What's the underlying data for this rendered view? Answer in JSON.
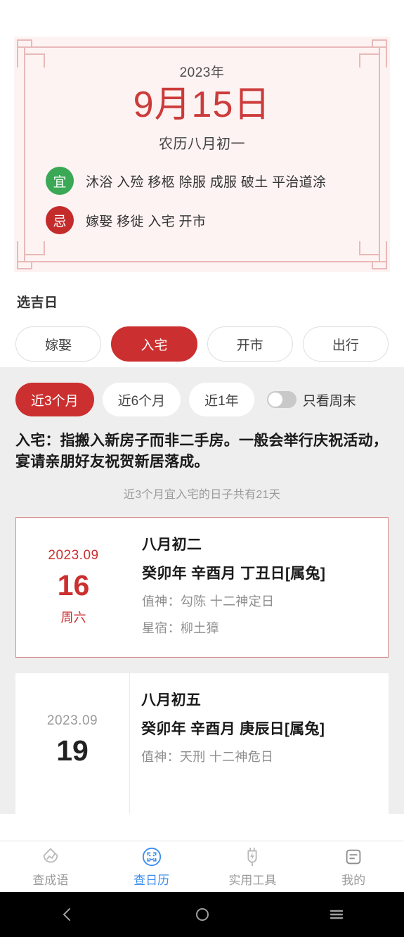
{
  "almanac": {
    "year": "2023年",
    "date": "9月15日",
    "lunar": "农历八月初一",
    "yi_badge": "宜",
    "yi_items": "沐浴 入殓 移柩 除服 成服 破土 平治道涂",
    "ji_badge": "忌",
    "ji_items": "嫁娶 移徙 入宅 开市"
  },
  "picker": {
    "title": "选吉日",
    "options": [
      {
        "label": "嫁娶",
        "active": false
      },
      {
        "label": "入宅",
        "active": true
      },
      {
        "label": "开市",
        "active": false
      },
      {
        "label": "出行",
        "active": false
      }
    ]
  },
  "filters": {
    "ranges": [
      {
        "label": "近3个月",
        "active": true
      },
      {
        "label": "近6个月",
        "active": false
      },
      {
        "label": "近1年",
        "active": false
      }
    ],
    "weekend_toggle_label": "只看周末",
    "weekend_toggle_on": false
  },
  "summary": {
    "description": "入宅：指搬入新房子而非二手房。一般会举行庆祝活动，宴请亲朋好友祝贺新居落成。",
    "count_text": "近3个月宜入宅的日子共有21天"
  },
  "days": [
    {
      "year_month": "2023.09",
      "day": "16",
      "weekday": "周六",
      "lunar_day": "八月初二",
      "ganzhi": "癸卯年 辛酉月 丁丑日[属兔]",
      "zhishen": "值神：勾陈  十二神定日",
      "xingxiu": "星宿：柳土獐",
      "highlight": true
    },
    {
      "year_month": "2023.09",
      "day": "19",
      "weekday": "",
      "lunar_day": "八月初五",
      "ganzhi": "癸卯年 辛酉月 庚辰日[属兔]",
      "zhishen": "值神：天刑  十二神危日",
      "xingxiu": "",
      "highlight": false
    }
  ],
  "tabbar": [
    {
      "label": "查成语",
      "icon": "idiom-drop-icon",
      "active": false
    },
    {
      "label": "查日历",
      "icon": "calendar-scan-icon",
      "active": true
    },
    {
      "label": "实用工具",
      "icon": "plug-tool-icon",
      "active": false
    },
    {
      "label": "我的",
      "icon": "profile-card-icon",
      "active": false
    }
  ],
  "system_nav": [
    {
      "name": "back-button"
    },
    {
      "name": "home-button"
    },
    {
      "name": "recents-button"
    }
  ],
  "colors": {
    "accent_red": "#cc2f2f",
    "date_red": "#cc3b3b",
    "yi_green": "#3aa855",
    "tab_blue": "#3d8ef0",
    "card_bg": "#fdf3f2",
    "gray_bg": "#eeeeee"
  }
}
